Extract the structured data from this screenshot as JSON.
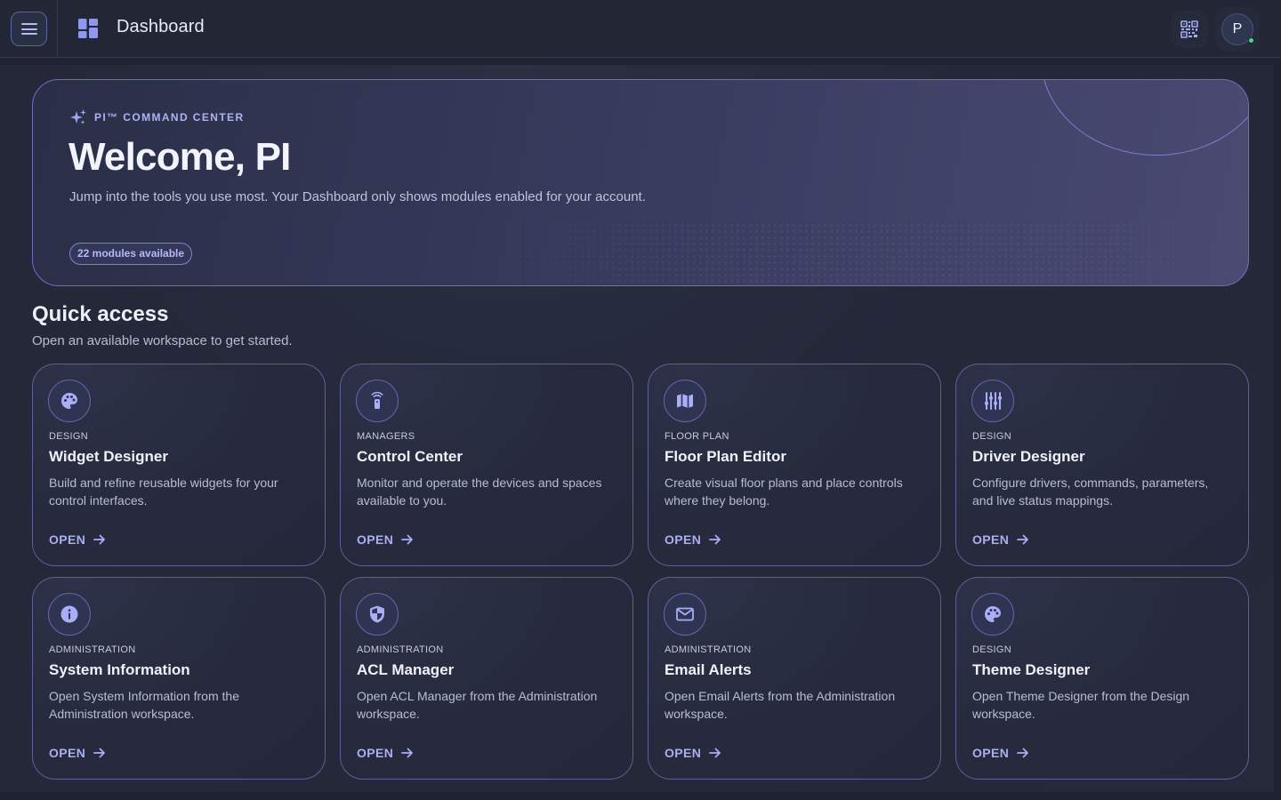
{
  "topbar": {
    "title": "Dashboard",
    "avatar_initial": "P"
  },
  "hero": {
    "kicker": "PI™ COMMAND CENTER",
    "title": "Welcome, PI",
    "subtitle": "Jump into the tools you use most. Your Dashboard only shows modules enabled for your account.",
    "badge": "22 modules available"
  },
  "quick_access": {
    "title": "Quick access",
    "subtitle": "Open an available workspace to get started.",
    "open_label": "OPEN",
    "cards": [
      {
        "category": "DESIGN",
        "name": "Widget Designer",
        "description": "Build and refine reusable widgets for your control interfaces.",
        "icon": "palette-icon"
      },
      {
        "category": "MANAGERS",
        "name": "Control Center",
        "description": "Monitor and operate the devices and spaces available to you.",
        "icon": "remote-icon"
      },
      {
        "category": "FLOOR PLAN",
        "name": "Floor Plan Editor",
        "description": "Create visual floor plans and place controls where they belong.",
        "icon": "map-icon"
      },
      {
        "category": "DESIGN",
        "name": "Driver Designer",
        "description": "Configure drivers, commands, parameters, and live status mappings.",
        "icon": "sliders-icon"
      },
      {
        "category": "ADMINISTRATION",
        "name": "System Information",
        "description": "Open System Information from the Administration workspace.",
        "icon": "info-icon"
      },
      {
        "category": "ADMINISTRATION",
        "name": "ACL Manager",
        "description": "Open ACL Manager from the Administration workspace.",
        "icon": "shield-icon"
      },
      {
        "category": "ADMINISTRATION",
        "name": "Email Alerts",
        "description": "Open Email Alerts from the Administration workspace.",
        "icon": "mail-icon"
      },
      {
        "category": "DESIGN",
        "name": "Theme Designer",
        "description": "Open Theme Designer from the Design workspace.",
        "icon": "palette-icon"
      }
    ]
  },
  "colors": {
    "accent": "#a9aef7",
    "background": "#1f2331",
    "card_border": "#5b6096",
    "status_online": "#4fd18b"
  }
}
